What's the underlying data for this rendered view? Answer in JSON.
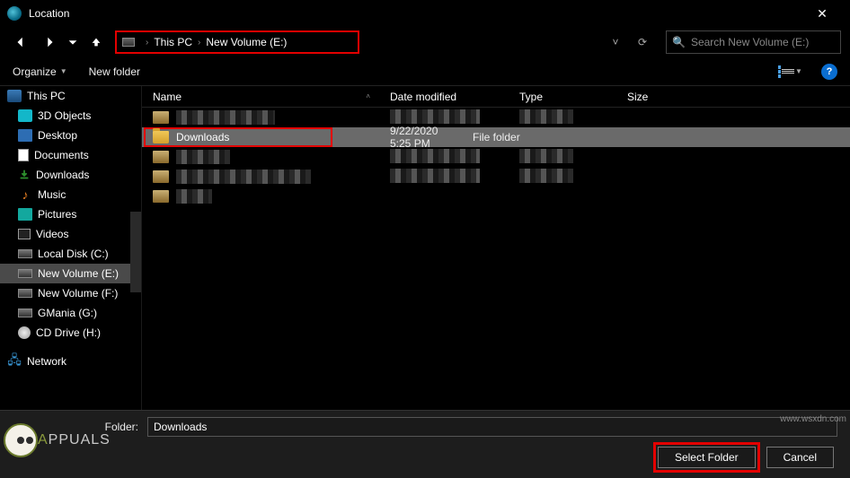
{
  "window": {
    "title": "Location"
  },
  "nav": {
    "breadcrumb": {
      "root": "This PC",
      "drive": "New Volume (E:)"
    },
    "search_placeholder": "Search New Volume (E:)"
  },
  "toolbar": {
    "organize": "Organize",
    "new_folder": "New folder"
  },
  "sidebar": {
    "root": "This PC",
    "items": [
      {
        "label": "3D Objects"
      },
      {
        "label": "Desktop"
      },
      {
        "label": "Documents"
      },
      {
        "label": "Downloads"
      },
      {
        "label": "Music"
      },
      {
        "label": "Pictures"
      },
      {
        "label": "Videos"
      },
      {
        "label": "Local Disk (C:)"
      },
      {
        "label": "New Volume (E:)"
      },
      {
        "label": "New Volume (F:)"
      },
      {
        "label": "GMania (G:)"
      },
      {
        "label": "CD Drive (H:)"
      }
    ],
    "network": "Network"
  },
  "columns": {
    "name": "Name",
    "date": "Date modified",
    "type": "Type",
    "size": "Size"
  },
  "files": {
    "selected": {
      "name": "Downloads",
      "date": "9/22/2020 5:25 PM",
      "type": "File folder"
    }
  },
  "bottom": {
    "folder_label": "Folder:",
    "folder_value": "Downloads",
    "select_btn": "Select Folder",
    "cancel_btn": "Cancel"
  },
  "watermark": {
    "brand_a": "A",
    "brand_rest": "PPUALS"
  },
  "site": "www.wsxdn.com"
}
